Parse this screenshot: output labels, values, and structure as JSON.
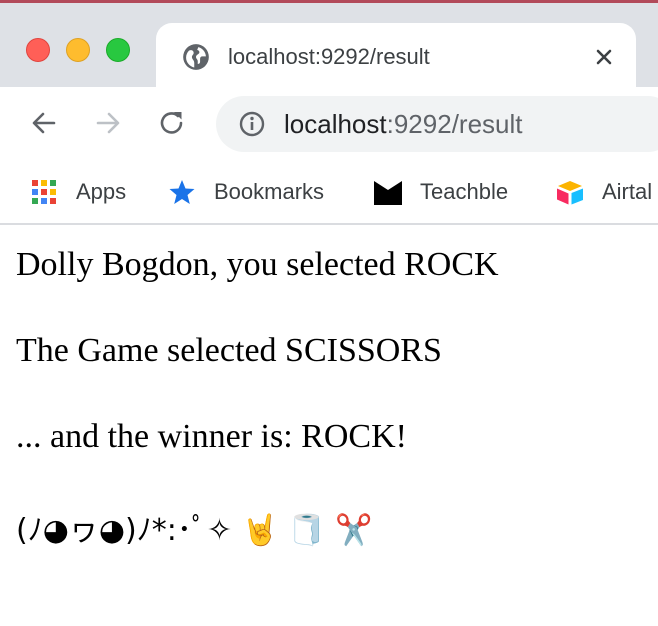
{
  "browser": {
    "tab": {
      "title": "localhost:9292/result",
      "favicon": "globe-icon"
    },
    "address_bar": {
      "host": "localhost",
      "path": ":9292/result",
      "security_icon": "info-icon"
    },
    "bookmarks": [
      {
        "label": "Apps",
        "icon": "apps-grid-icon"
      },
      {
        "label": "Bookmarks",
        "icon": "star-icon"
      },
      {
        "label": "Teachble",
        "icon": "teachable-logo-icon"
      },
      {
        "label": "Airtal",
        "icon": "airtable-logo-icon"
      }
    ],
    "colors": {
      "tab_strip": "#dee1e6",
      "omnibox": "#f1f3f4",
      "close_red": "#ff5f57",
      "minimize_yellow": "#febc2e",
      "zoom_green": "#28c840",
      "star_blue": "#1a73e8"
    }
  },
  "page": {
    "player_line": "Dolly Bogdon, you selected ROCK",
    "game_line": "The Game selected SCISSORS",
    "winner_line": "... and the winner is: ROCK!",
    "celebration_line": "(ﾉ◕ヮ◕)ﾉ*:･ﾟ✧ 🤘 🧻 ✂️"
  }
}
